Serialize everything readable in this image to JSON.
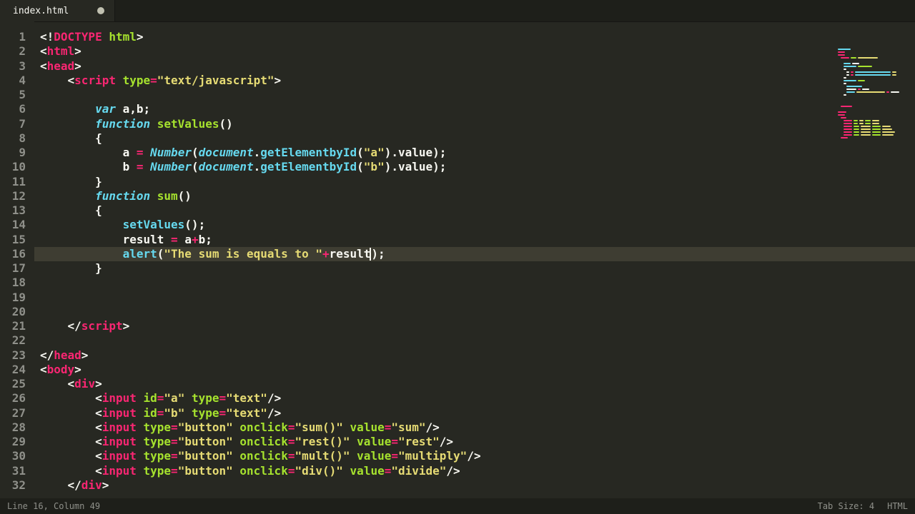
{
  "tab": {
    "filename": "index.html",
    "dirty": true
  },
  "status": {
    "left": "Line 16, Column 49",
    "tabsize": "Tab Size: 4",
    "lang": "HTML"
  },
  "code": {
    "lines": [
      {
        "n": 1,
        "indent": 0,
        "tokens": [
          [
            "p",
            "<!"
          ],
          [
            "tg",
            "DOCTYPE"
          ],
          [
            "p",
            " "
          ],
          [
            "an",
            "html"
          ],
          [
            "p",
            ">"
          ]
        ]
      },
      {
        "n": 2,
        "indent": 0,
        "tokens": [
          [
            "p",
            "<"
          ],
          [
            "tg",
            "html"
          ],
          [
            "p",
            ">"
          ]
        ]
      },
      {
        "n": 3,
        "indent": 0,
        "tokens": [
          [
            "p",
            "<"
          ],
          [
            "tg",
            "head"
          ],
          [
            "p",
            ">"
          ]
        ]
      },
      {
        "n": 4,
        "indent": 1,
        "tokens": [
          [
            "p",
            "<"
          ],
          [
            "tg",
            "script"
          ],
          [
            "p",
            " "
          ],
          [
            "an",
            "type"
          ],
          [
            "op",
            "="
          ],
          [
            "s",
            "\"text/javascript\""
          ],
          [
            "p",
            ">"
          ]
        ]
      },
      {
        "n": 5,
        "indent": 0,
        "tokens": []
      },
      {
        "n": 6,
        "indent": 2,
        "tokens": [
          [
            "st",
            "var"
          ],
          [
            "p",
            " "
          ],
          [
            "id",
            "a"
          ],
          [
            "p",
            ","
          ],
          [
            "id",
            "b"
          ],
          [
            "p",
            ";"
          ]
        ]
      },
      {
        "n": 7,
        "indent": 2,
        "tokens": [
          [
            "st",
            "function"
          ],
          [
            "p",
            " "
          ],
          [
            "fn",
            "setValues"
          ],
          [
            "p",
            "()"
          ]
        ]
      },
      {
        "n": 8,
        "indent": 2,
        "tokens": [
          [
            "p",
            "{"
          ]
        ]
      },
      {
        "n": 9,
        "indent": 3,
        "tokens": [
          [
            "id",
            "a"
          ],
          [
            "p",
            " "
          ],
          [
            "op",
            "="
          ],
          [
            "p",
            " "
          ],
          [
            "st",
            "Number"
          ],
          [
            "p",
            "("
          ],
          [
            "obj",
            "document"
          ],
          [
            "p",
            "."
          ],
          [
            "mc",
            "getElementbyId"
          ],
          [
            "p",
            "("
          ],
          [
            "s",
            "\"a\""
          ],
          [
            "p",
            ")."
          ],
          [
            "id",
            "value"
          ],
          [
            "p",
            ");"
          ]
        ]
      },
      {
        "n": 10,
        "indent": 3,
        "tokens": [
          [
            "id",
            "b"
          ],
          [
            "p",
            " "
          ],
          [
            "op",
            "="
          ],
          [
            "p",
            " "
          ],
          [
            "st",
            "Number"
          ],
          [
            "p",
            "("
          ],
          [
            "obj",
            "document"
          ],
          [
            "p",
            "."
          ],
          [
            "mc",
            "getElementbyId"
          ],
          [
            "p",
            "("
          ],
          [
            "s",
            "\"b\""
          ],
          [
            "p",
            ")."
          ],
          [
            "id",
            "value"
          ],
          [
            "p",
            ");"
          ]
        ]
      },
      {
        "n": 11,
        "indent": 2,
        "tokens": [
          [
            "p",
            "}"
          ]
        ]
      },
      {
        "n": 12,
        "indent": 2,
        "tokens": [
          [
            "st",
            "function"
          ],
          [
            "p",
            " "
          ],
          [
            "fn",
            "sum"
          ],
          [
            "p",
            "()"
          ]
        ]
      },
      {
        "n": 13,
        "indent": 2,
        "tokens": [
          [
            "p",
            "{"
          ]
        ]
      },
      {
        "n": 14,
        "indent": 3,
        "tokens": [
          [
            "mc",
            "setValues"
          ],
          [
            "p",
            "();"
          ]
        ]
      },
      {
        "n": 15,
        "indent": 3,
        "tokens": [
          [
            "id",
            "result"
          ],
          [
            "p",
            " "
          ],
          [
            "op",
            "="
          ],
          [
            "p",
            " "
          ],
          [
            "id",
            "a"
          ],
          [
            "op",
            "+"
          ],
          [
            "id",
            "b"
          ],
          [
            "p",
            ";"
          ]
        ]
      },
      {
        "n": 16,
        "indent": 3,
        "current": true,
        "tokens": [
          [
            "mc",
            "alert"
          ],
          [
            "p",
            "("
          ],
          [
            "s",
            "\"The sum is equals to \""
          ],
          [
            "op",
            "+"
          ],
          [
            "id",
            "result"
          ],
          [
            "cursor",
            ""
          ],
          [
            "p",
            ");"
          ]
        ]
      },
      {
        "n": 17,
        "indent": 2,
        "tokens": [
          [
            "p",
            "}"
          ]
        ]
      },
      {
        "n": 18,
        "indent": 0,
        "tokens": []
      },
      {
        "n": 19,
        "indent": 0,
        "tokens": []
      },
      {
        "n": 20,
        "indent": 0,
        "tokens": []
      },
      {
        "n": 21,
        "indent": 1,
        "tokens": [
          [
            "p",
            "</"
          ],
          [
            "tg",
            "script"
          ],
          [
            "p",
            ">"
          ]
        ]
      },
      {
        "n": 22,
        "indent": 0,
        "tokens": []
      },
      {
        "n": 23,
        "indent": 0,
        "tokens": [
          [
            "p",
            "</"
          ],
          [
            "tg",
            "head"
          ],
          [
            "p",
            ">"
          ]
        ]
      },
      {
        "n": 24,
        "indent": 0,
        "tokens": [
          [
            "p",
            "<"
          ],
          [
            "tg",
            "body"
          ],
          [
            "p",
            ">"
          ]
        ]
      },
      {
        "n": 25,
        "indent": 1,
        "tokens": [
          [
            "p",
            "<"
          ],
          [
            "tg",
            "div"
          ],
          [
            "p",
            ">"
          ]
        ]
      },
      {
        "n": 26,
        "indent": 2,
        "tokens": [
          [
            "p",
            "<"
          ],
          [
            "tg",
            "input"
          ],
          [
            "p",
            " "
          ],
          [
            "an",
            "id"
          ],
          [
            "op",
            "="
          ],
          [
            "s",
            "\"a\""
          ],
          [
            "p",
            " "
          ],
          [
            "an",
            "type"
          ],
          [
            "op",
            "="
          ],
          [
            "s",
            "\"text\""
          ],
          [
            "p",
            "/>"
          ]
        ]
      },
      {
        "n": 27,
        "indent": 2,
        "tokens": [
          [
            "p",
            "<"
          ],
          [
            "tg",
            "input"
          ],
          [
            "p",
            " "
          ],
          [
            "an",
            "id"
          ],
          [
            "op",
            "="
          ],
          [
            "s",
            "\"b\""
          ],
          [
            "p",
            " "
          ],
          [
            "an",
            "type"
          ],
          [
            "op",
            "="
          ],
          [
            "s",
            "\"text\""
          ],
          [
            "p",
            "/>"
          ]
        ]
      },
      {
        "n": 28,
        "indent": 2,
        "tokens": [
          [
            "p",
            "<"
          ],
          [
            "tg",
            "input"
          ],
          [
            "p",
            " "
          ],
          [
            "an",
            "type"
          ],
          [
            "op",
            "="
          ],
          [
            "s",
            "\"button\""
          ],
          [
            "p",
            " "
          ],
          [
            "an",
            "onclick"
          ],
          [
            "op",
            "="
          ],
          [
            "s",
            "\"sum()\""
          ],
          [
            "p",
            " "
          ],
          [
            "an",
            "value"
          ],
          [
            "op",
            "="
          ],
          [
            "s",
            "\"sum\""
          ],
          [
            "p",
            "/>"
          ]
        ]
      },
      {
        "n": 29,
        "indent": 2,
        "tokens": [
          [
            "p",
            "<"
          ],
          [
            "tg",
            "input"
          ],
          [
            "p",
            " "
          ],
          [
            "an",
            "type"
          ],
          [
            "op",
            "="
          ],
          [
            "s",
            "\"button\""
          ],
          [
            "p",
            " "
          ],
          [
            "an",
            "onclick"
          ],
          [
            "op",
            "="
          ],
          [
            "s",
            "\"rest()\""
          ],
          [
            "p",
            " "
          ],
          [
            "an",
            "value"
          ],
          [
            "op",
            "="
          ],
          [
            "s",
            "\"rest\""
          ],
          [
            "p",
            "/>"
          ]
        ]
      },
      {
        "n": 30,
        "indent": 2,
        "tokens": [
          [
            "p",
            "<"
          ],
          [
            "tg",
            "input"
          ],
          [
            "p",
            " "
          ],
          [
            "an",
            "type"
          ],
          [
            "op",
            "="
          ],
          [
            "s",
            "\"button\""
          ],
          [
            "p",
            " "
          ],
          [
            "an",
            "onclick"
          ],
          [
            "op",
            "="
          ],
          [
            "s",
            "\"mult()\""
          ],
          [
            "p",
            " "
          ],
          [
            "an",
            "value"
          ],
          [
            "op",
            "="
          ],
          [
            "s",
            "\"multiply\""
          ],
          [
            "p",
            "/>"
          ]
        ]
      },
      {
        "n": 31,
        "indent": 2,
        "tokens": [
          [
            "p",
            "<"
          ],
          [
            "tg",
            "input"
          ],
          [
            "p",
            " "
          ],
          [
            "an",
            "type"
          ],
          [
            "op",
            "="
          ],
          [
            "s",
            "\"button\""
          ],
          [
            "p",
            " "
          ],
          [
            "an",
            "onclick"
          ],
          [
            "op",
            "="
          ],
          [
            "s",
            "\"div()\""
          ],
          [
            "p",
            " "
          ],
          [
            "an",
            "value"
          ],
          [
            "op",
            "="
          ],
          [
            "s",
            "\"divide\""
          ],
          [
            "p",
            "/>"
          ]
        ]
      },
      {
        "n": 32,
        "indent": 1,
        "tokens": [
          [
            "p",
            "</"
          ],
          [
            "tg",
            "div"
          ],
          [
            "p",
            ">"
          ]
        ]
      }
    ]
  },
  "minimap": [
    [
      [
        0,
        "#66d9ef",
        18
      ]
    ],
    [
      [
        0,
        "#f92672",
        10
      ]
    ],
    [
      [
        0,
        "#f92672",
        10
      ]
    ],
    [
      [
        4,
        "#f92672",
        12
      ],
      [
        18,
        "#a6e22e",
        8
      ],
      [
        28,
        "#e6db74",
        28
      ]
    ],
    [],
    [
      [
        8,
        "#66d9ef",
        10
      ],
      [
        20,
        "#f8f8f2",
        10
      ]
    ],
    [
      [
        8,
        "#66d9ef",
        18
      ],
      [
        28,
        "#a6e22e",
        20
      ]
    ],
    [
      [
        8,
        "#f8f8f2",
        4
      ]
    ],
    [
      [
        12,
        "#f8f8f2",
        4
      ],
      [
        18,
        "#f92672",
        4
      ],
      [
        24,
        "#66d9ef",
        50
      ],
      [
        76,
        "#e6db74",
        6
      ]
    ],
    [
      [
        12,
        "#f8f8f2",
        4
      ],
      [
        18,
        "#f92672",
        4
      ],
      [
        24,
        "#66d9ef",
        50
      ],
      [
        76,
        "#e6db74",
        6
      ]
    ],
    [
      [
        8,
        "#f8f8f2",
        4
      ]
    ],
    [
      [
        8,
        "#66d9ef",
        18
      ],
      [
        28,
        "#a6e22e",
        10
      ]
    ],
    [
      [
        8,
        "#f8f8f2",
        4
      ]
    ],
    [
      [
        12,
        "#66d9ef",
        22
      ]
    ],
    [
      [
        12,
        "#f8f8f2",
        14
      ],
      [
        28,
        "#f92672",
        4
      ],
      [
        34,
        "#f8f8f2",
        10
      ]
    ],
    [
      [
        12,
        "#66d9ef",
        12
      ],
      [
        26,
        "#e6db74",
        40
      ],
      [
        68,
        "#f92672",
        4
      ],
      [
        74,
        "#f8f8f2",
        12
      ]
    ],
    [
      [
        8,
        "#f8f8f2",
        4
      ]
    ],
    [],
    [],
    [],
    [
      [
        4,
        "#f92672",
        16
      ]
    ],
    [],
    [
      [
        0,
        "#f92672",
        12
      ]
    ],
    [
      [
        0,
        "#f92672",
        10
      ]
    ],
    [
      [
        4,
        "#f92672",
        8
      ]
    ],
    [
      [
        8,
        "#f92672",
        12
      ],
      [
        22,
        "#a6e22e",
        6
      ],
      [
        30,
        "#e6db74",
        6
      ],
      [
        38,
        "#a6e22e",
        8
      ],
      [
        48,
        "#e6db74",
        10
      ]
    ],
    [
      [
        8,
        "#f92672",
        12
      ],
      [
        22,
        "#a6e22e",
        6
      ],
      [
        30,
        "#e6db74",
        6
      ],
      [
        38,
        "#a6e22e",
        8
      ],
      [
        48,
        "#e6db74",
        10
      ]
    ],
    [
      [
        8,
        "#f92672",
        12
      ],
      [
        22,
        "#a6e22e",
        8
      ],
      [
        32,
        "#e6db74",
        14
      ],
      [
        48,
        "#a6e22e",
        12
      ],
      [
        62,
        "#e6db74",
        12
      ]
    ],
    [
      [
        8,
        "#f92672",
        12
      ],
      [
        22,
        "#a6e22e",
        8
      ],
      [
        32,
        "#e6db74",
        14
      ],
      [
        48,
        "#a6e22e",
        12
      ],
      [
        62,
        "#e6db74",
        14
      ]
    ],
    [
      [
        8,
        "#f92672",
        12
      ],
      [
        22,
        "#a6e22e",
        8
      ],
      [
        32,
        "#e6db74",
        14
      ],
      [
        48,
        "#a6e22e",
        12
      ],
      [
        62,
        "#e6db74",
        18
      ]
    ],
    [
      [
        8,
        "#f92672",
        12
      ],
      [
        22,
        "#a6e22e",
        8
      ],
      [
        32,
        "#e6db74",
        14
      ],
      [
        48,
        "#a6e22e",
        12
      ],
      [
        62,
        "#e6db74",
        16
      ]
    ],
    [
      [
        4,
        "#f92672",
        10
      ]
    ]
  ]
}
